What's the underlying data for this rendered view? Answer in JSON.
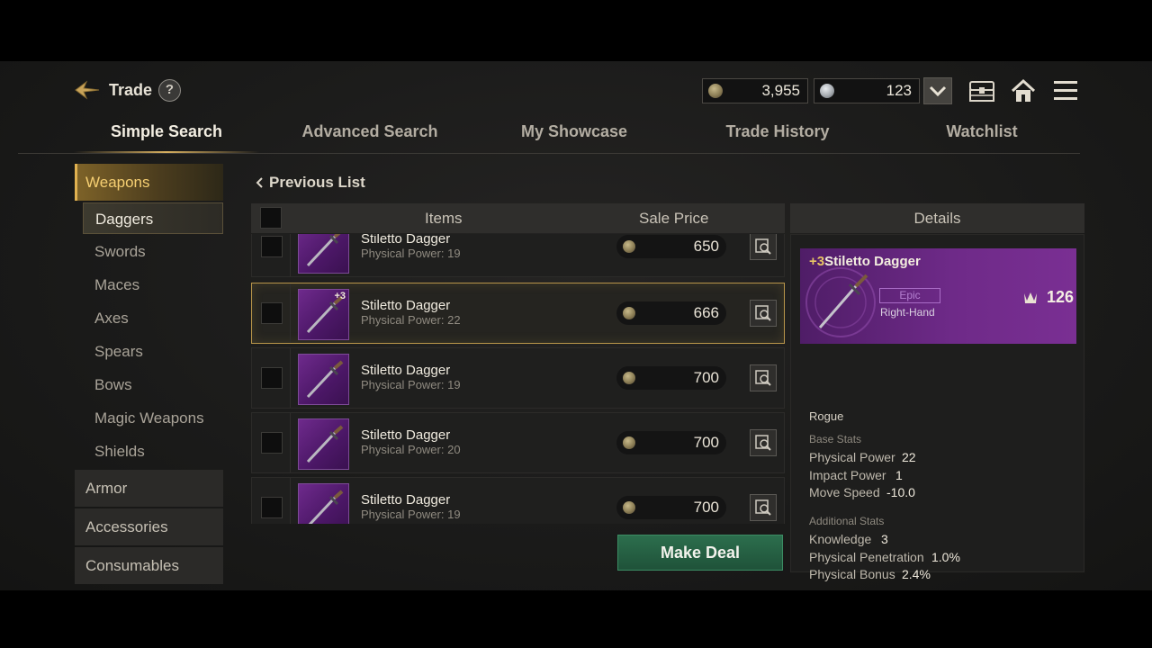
{
  "header": {
    "title": "Trade",
    "help_label": "?",
    "currencies": [
      {
        "name": "gold-coin",
        "amount": "3,955"
      },
      {
        "name": "silver-coin",
        "amount": "123"
      }
    ],
    "icons": [
      "chevron-down-icon",
      "storage-chest-icon",
      "home-icon",
      "menu-icon"
    ]
  },
  "tabs": [
    {
      "label": "Simple Search",
      "active": true
    },
    {
      "label": "Advanced Search",
      "active": false
    },
    {
      "label": "My Showcase",
      "active": false
    },
    {
      "label": "Trade History",
      "active": false
    },
    {
      "label": "Watchlist",
      "active": false
    }
  ],
  "sidebar": {
    "categories": {
      "weapons": "Weapons",
      "armor": "Armor",
      "accessories": "Accessories",
      "consumables": "Consumables"
    },
    "subcategories": [
      "Daggers",
      "Swords",
      "Maces",
      "Axes",
      "Spears",
      "Bows",
      "Magic Weapons",
      "Shields"
    ],
    "active_subcategory": "Daggers"
  },
  "list": {
    "back_label": "Previous List",
    "col_items": "Items",
    "col_price": "Sale Price",
    "rows": [
      {
        "name": "Stiletto Dagger",
        "stat": "Physical Power: 19",
        "enhance": "",
        "price": "650",
        "selected": false
      },
      {
        "name": "Stiletto Dagger",
        "stat": "Physical Power: 22",
        "enhance": "+3",
        "price": "666",
        "selected": true
      },
      {
        "name": "Stiletto Dagger",
        "stat": "Physical Power: 19",
        "enhance": "",
        "price": "700",
        "selected": false
      },
      {
        "name": "Stiletto Dagger",
        "stat": "Physical Power: 20",
        "enhance": "",
        "price": "700",
        "selected": false
      },
      {
        "name": "Stiletto Dagger",
        "stat": "Physical Power: 19",
        "enhance": "",
        "price": "700",
        "selected": false
      }
    ],
    "action_label": "Make Deal"
  },
  "details": {
    "header": "Details",
    "enhance": "+3",
    "item_name": "Stiletto Dagger",
    "rarity": "Epic",
    "slot": "Right-Hand",
    "score": "126",
    "class": "Rogue",
    "base_stats_label": "Base Stats",
    "base_stats": [
      {
        "name": "Physical Power",
        "value": "22"
      },
      {
        "name": "Impact Power",
        "value": "1"
      },
      {
        "name": "Move Speed",
        "value": "-10.0"
      }
    ],
    "additional_stats_label": "Additional Stats",
    "additional_stats": [
      {
        "name": "Knowledge",
        "value": "3"
      },
      {
        "name": "Physical Penetration",
        "value": "1.0%"
      },
      {
        "name": "Physical Bonus",
        "value": "2.4%"
      }
    ]
  },
  "colors": {
    "accent_gold": "#d8b060",
    "epic_purple": "#6e2a88",
    "deal_green": "#2c6e4d"
  }
}
